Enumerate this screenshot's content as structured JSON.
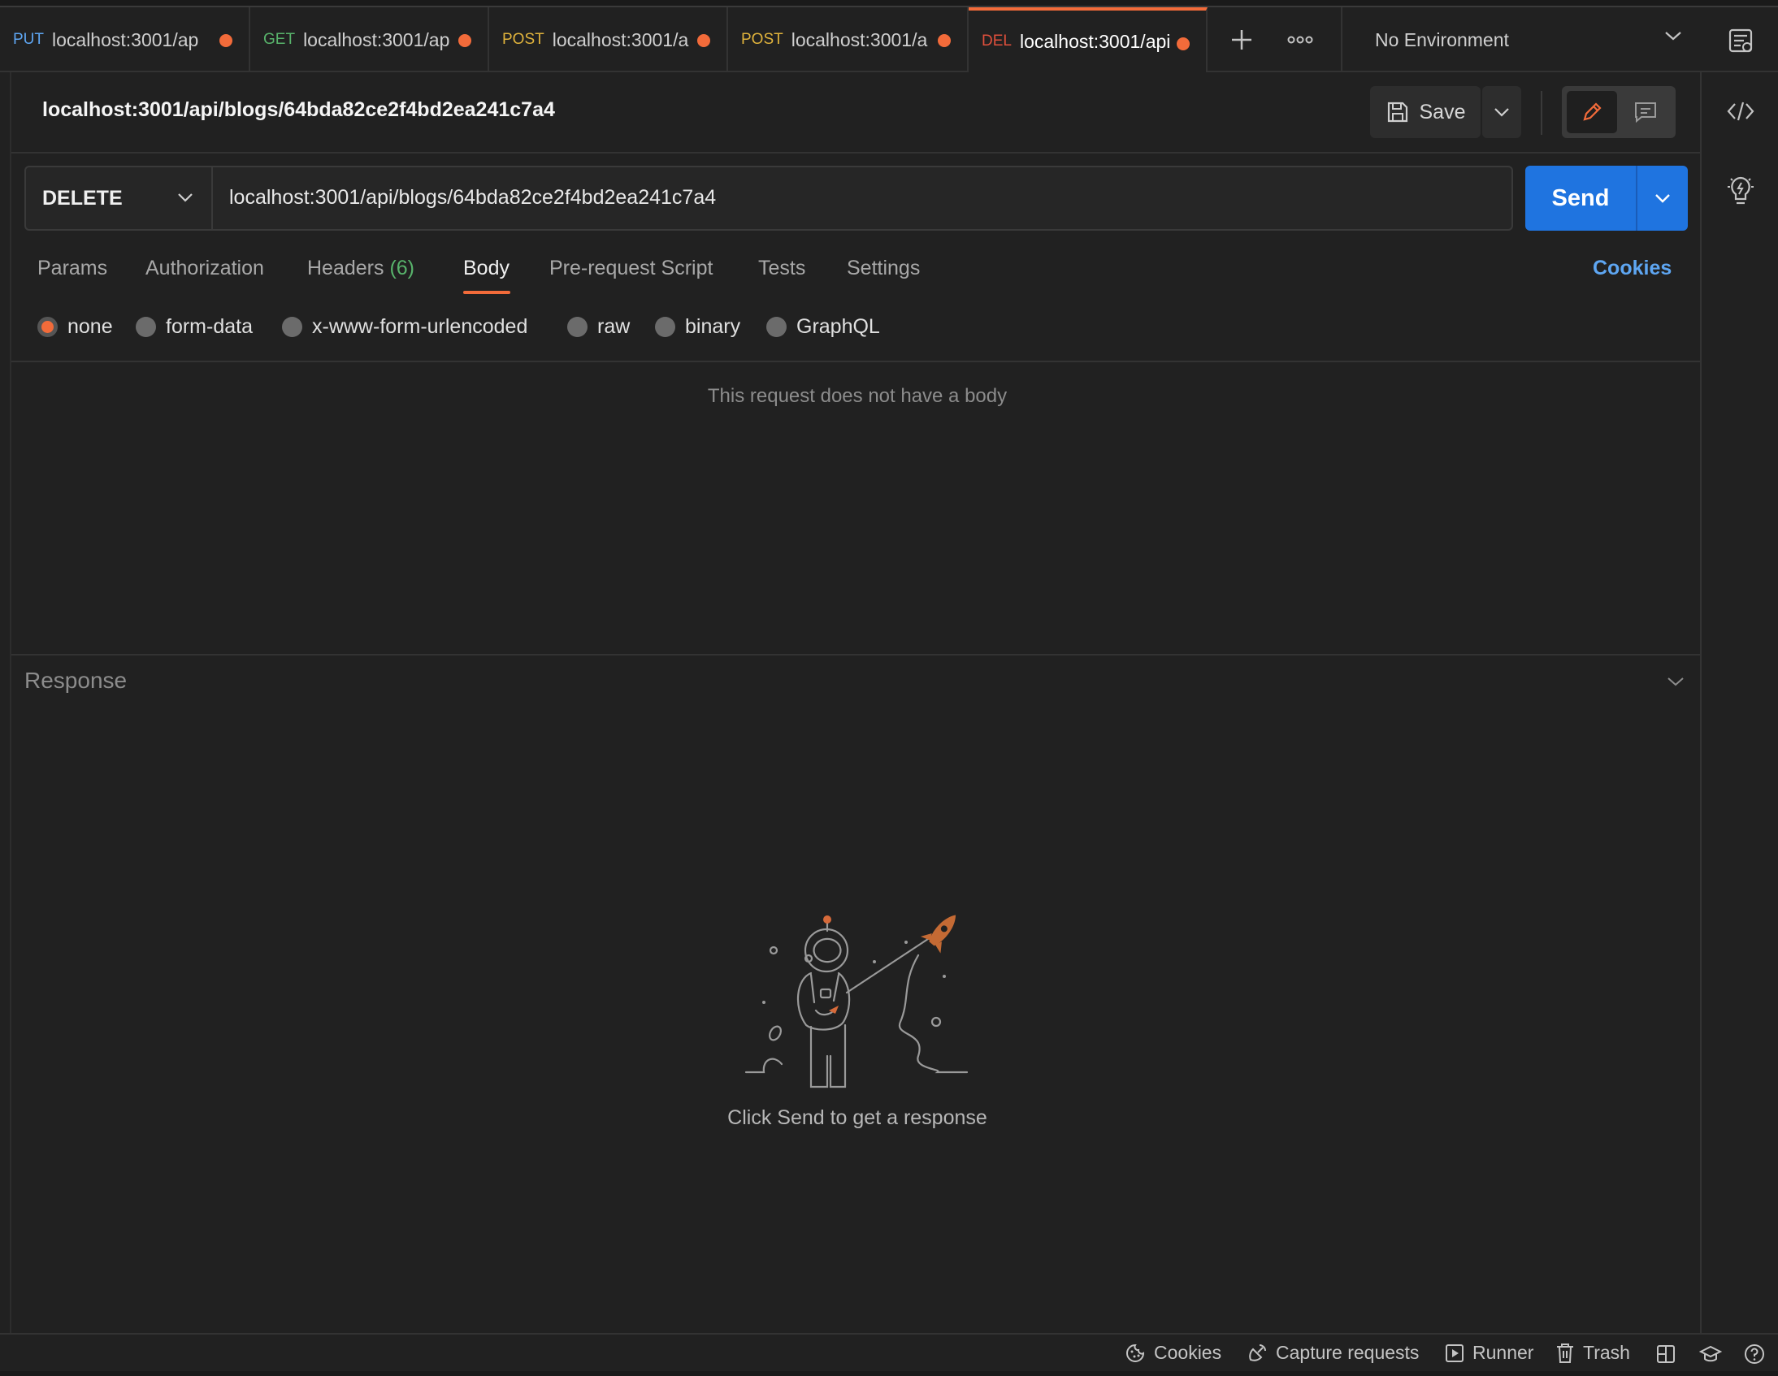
{
  "tabs": [
    {
      "method": "PUT",
      "method_color": "#5ea6f2",
      "label": "localhost:3001/ap"
    },
    {
      "method": "GET",
      "method_color": "#58b36b",
      "label": "localhost:3001/ap"
    },
    {
      "method": "POST",
      "method_color": "#e0b33c",
      "label": "localhost:3001/a"
    },
    {
      "method": "POST",
      "method_color": "#e0b33c",
      "label": "localhost:3001/a"
    },
    {
      "method": "DEL",
      "method_color": "#e0503c",
      "label": "localhost:3001/api"
    }
  ],
  "environment": {
    "selected": "No Environment"
  },
  "request": {
    "title": "localhost:3001/api/blogs/64bda82ce2f4bd2ea241c7a4",
    "method": "DELETE",
    "url": "localhost:3001/api/blogs/64bda82ce2f4bd2ea241c7a4",
    "save_label": "Save",
    "send_label": "Send"
  },
  "request_tabs": {
    "params": "Params",
    "authorization": "Authorization",
    "headers": "Headers",
    "headers_count": "(6)",
    "body": "Body",
    "prerequest": "Pre-request Script",
    "tests": "Tests",
    "settings": "Settings",
    "cookies": "Cookies"
  },
  "body_options": {
    "none": "none",
    "form_data": "form-data",
    "urlencoded": "x-www-form-urlencoded",
    "raw": "raw",
    "binary": "binary",
    "graphql": "GraphQL",
    "selected": "none"
  },
  "body_empty_message": "This request does not have a body",
  "response": {
    "label": "Response",
    "empty_message": "Click Send to get a response"
  },
  "statusbar": {
    "cookies": "Cookies",
    "capture": "Capture requests",
    "runner": "Runner",
    "trash": "Trash"
  },
  "colors": {
    "accent": "#f26b3a",
    "send": "#1f74e0",
    "link": "#5ea6f2",
    "headers_count": "#58b36b"
  }
}
